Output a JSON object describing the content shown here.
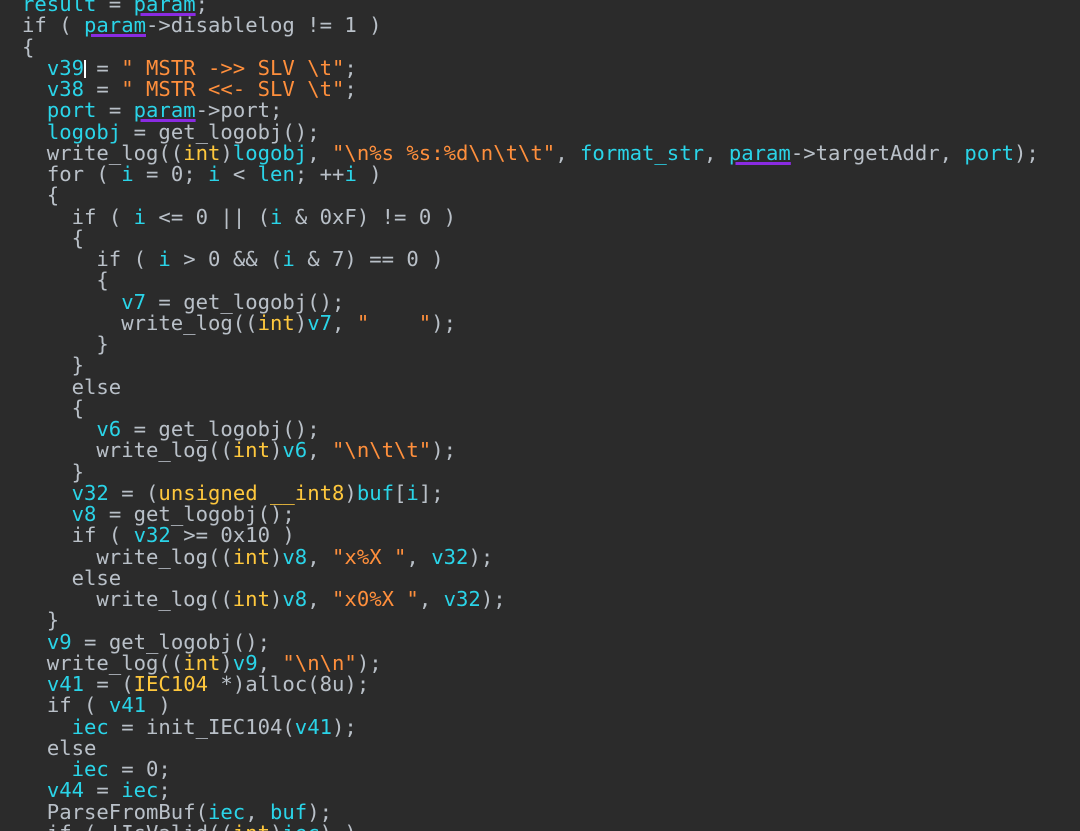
{
  "code_lines": [
    [
      [
        "var",
        "result"
      ],
      [
        "pl",
        " = "
      ],
      [
        "hl",
        "param"
      ],
      [
        "pl",
        ";"
      ]
    ],
    [
      [
        "kw",
        "if ( "
      ],
      [
        "hl",
        "param"
      ],
      [
        "pl",
        "->disablelog != 1 )"
      ]
    ],
    [
      [
        "pl",
        "{"
      ]
    ],
    [
      [
        "pl",
        "  "
      ],
      [
        "var",
        "v39"
      ],
      [
        "cur",
        ""
      ],
      [
        "pl",
        " = "
      ],
      [
        "str",
        "\" MSTR ->> SLV \\t\""
      ],
      [
        "pl",
        ";"
      ]
    ],
    [
      [
        "pl",
        "  "
      ],
      [
        "var",
        "v38"
      ],
      [
        "pl",
        " = "
      ],
      [
        "str",
        "\" MSTR <<- SLV \\t\""
      ],
      [
        "pl",
        ";"
      ]
    ],
    [
      [
        "pl",
        "  "
      ],
      [
        "var",
        "port"
      ],
      [
        "pl",
        " = "
      ],
      [
        "hl",
        "param"
      ],
      [
        "pl",
        "->port;"
      ]
    ],
    [
      [
        "pl",
        "  "
      ],
      [
        "var",
        "logobj"
      ],
      [
        "pl",
        " = get_logobj();"
      ]
    ],
    [
      [
        "pl",
        "  write_log(("
      ],
      [
        "typ",
        "int"
      ],
      [
        "pl",
        ")"
      ],
      [
        "var",
        "logobj"
      ],
      [
        "pl",
        ", "
      ],
      [
        "str",
        "\"\\n%s %s:%d\\n\\t\\t\""
      ],
      [
        "pl",
        ", "
      ],
      [
        "var",
        "format_str"
      ],
      [
        "pl",
        ", "
      ],
      [
        "hl",
        "param"
      ],
      [
        "pl",
        "->targetAddr, "
      ],
      [
        "var",
        "port"
      ],
      [
        "pl",
        ");"
      ]
    ],
    [
      [
        "pl",
        "  "
      ],
      [
        "kw",
        "for"
      ],
      [
        "pl",
        " ( "
      ],
      [
        "var",
        "i"
      ],
      [
        "pl",
        " = 0; "
      ],
      [
        "var",
        "i"
      ],
      [
        "pl",
        " < "
      ],
      [
        "var",
        "len"
      ],
      [
        "pl",
        "; ++"
      ],
      [
        "var",
        "i"
      ],
      [
        "pl",
        " )"
      ]
    ],
    [
      [
        "pl",
        "  {"
      ]
    ],
    [
      [
        "pl",
        "    "
      ],
      [
        "kw",
        "if"
      ],
      [
        "pl",
        " ( "
      ],
      [
        "var",
        "i"
      ],
      [
        "pl",
        " <= 0 || ("
      ],
      [
        "var",
        "i"
      ],
      [
        "pl",
        " & 0xF) != 0 )"
      ]
    ],
    [
      [
        "pl",
        "    {"
      ]
    ],
    [
      [
        "pl",
        "      "
      ],
      [
        "kw",
        "if"
      ],
      [
        "pl",
        " ( "
      ],
      [
        "var",
        "i"
      ],
      [
        "pl",
        " > 0 && ("
      ],
      [
        "var",
        "i"
      ],
      [
        "pl",
        " & 7) == 0 )"
      ]
    ],
    [
      [
        "pl",
        "      {"
      ]
    ],
    [
      [
        "pl",
        "        "
      ],
      [
        "var",
        "v7"
      ],
      [
        "pl",
        " = get_logobj();"
      ]
    ],
    [
      [
        "pl",
        "        write_log(("
      ],
      [
        "typ",
        "int"
      ],
      [
        "pl",
        ")"
      ],
      [
        "var",
        "v7"
      ],
      [
        "pl",
        ", "
      ],
      [
        "str",
        "\"    \""
      ],
      [
        "pl",
        ");"
      ]
    ],
    [
      [
        "pl",
        "      }"
      ]
    ],
    [
      [
        "pl",
        "    }"
      ]
    ],
    [
      [
        "pl",
        "    "
      ],
      [
        "kw",
        "else"
      ]
    ],
    [
      [
        "pl",
        "    {"
      ]
    ],
    [
      [
        "pl",
        "      "
      ],
      [
        "var",
        "v6"
      ],
      [
        "pl",
        " = get_logobj();"
      ]
    ],
    [
      [
        "pl",
        "      write_log(("
      ],
      [
        "typ",
        "int"
      ],
      [
        "pl",
        ")"
      ],
      [
        "var",
        "v6"
      ],
      [
        "pl",
        ", "
      ],
      [
        "str",
        "\"\\n\\t\\t\""
      ],
      [
        "pl",
        ");"
      ]
    ],
    [
      [
        "pl",
        "    }"
      ]
    ],
    [
      [
        "pl",
        "    "
      ],
      [
        "var",
        "v32"
      ],
      [
        "pl",
        " = ("
      ],
      [
        "typ",
        "unsigned __int8"
      ],
      [
        "pl",
        ")"
      ],
      [
        "var",
        "buf"
      ],
      [
        "pl",
        "["
      ],
      [
        "var",
        "i"
      ],
      [
        "pl",
        "];"
      ]
    ],
    [
      [
        "pl",
        "    "
      ],
      [
        "var",
        "v8"
      ],
      [
        "pl",
        " = get_logobj();"
      ]
    ],
    [
      [
        "pl",
        "    "
      ],
      [
        "kw",
        "if"
      ],
      [
        "pl",
        " ( "
      ],
      [
        "var",
        "v32"
      ],
      [
        "pl",
        " >= 0x10 )"
      ]
    ],
    [
      [
        "pl",
        "      write_log(("
      ],
      [
        "typ",
        "int"
      ],
      [
        "pl",
        ")"
      ],
      [
        "var",
        "v8"
      ],
      [
        "pl",
        ", "
      ],
      [
        "str",
        "\"x%X \""
      ],
      [
        "pl",
        ", "
      ],
      [
        "var",
        "v32"
      ],
      [
        "pl",
        ");"
      ]
    ],
    [
      [
        "pl",
        "    "
      ],
      [
        "kw",
        "else"
      ]
    ],
    [
      [
        "pl",
        "      write_log(("
      ],
      [
        "typ",
        "int"
      ],
      [
        "pl",
        ")"
      ],
      [
        "var",
        "v8"
      ],
      [
        "pl",
        ", "
      ],
      [
        "str",
        "\"x0%X \""
      ],
      [
        "pl",
        ", "
      ],
      [
        "var",
        "v32"
      ],
      [
        "pl",
        ");"
      ]
    ],
    [
      [
        "pl",
        "  }"
      ]
    ],
    [
      [
        "pl",
        "  "
      ],
      [
        "var",
        "v9"
      ],
      [
        "pl",
        " = get_logobj();"
      ]
    ],
    [
      [
        "pl",
        "  write_log(("
      ],
      [
        "typ",
        "int"
      ],
      [
        "pl",
        ")"
      ],
      [
        "var",
        "v9"
      ],
      [
        "pl",
        ", "
      ],
      [
        "str",
        "\"\\n\\n\""
      ],
      [
        "pl",
        ");"
      ]
    ],
    [
      [
        "pl",
        "  "
      ],
      [
        "var",
        "v41"
      ],
      [
        "pl",
        " = ("
      ],
      [
        "typ",
        "IEC104"
      ],
      [
        "pl",
        " *)alloc(8u);"
      ]
    ],
    [
      [
        "pl",
        "  "
      ],
      [
        "kw",
        "if"
      ],
      [
        "pl",
        " ( "
      ],
      [
        "var",
        "v41"
      ],
      [
        "pl",
        " )"
      ]
    ],
    [
      [
        "pl",
        "    "
      ],
      [
        "var",
        "iec"
      ],
      [
        "pl",
        " = init_IEC104("
      ],
      [
        "var",
        "v41"
      ],
      [
        "pl",
        ");"
      ]
    ],
    [
      [
        "pl",
        "  "
      ],
      [
        "kw",
        "else"
      ]
    ],
    [
      [
        "pl",
        "    "
      ],
      [
        "var",
        "iec"
      ],
      [
        "pl",
        " = 0;"
      ]
    ],
    [
      [
        "pl",
        "  "
      ],
      [
        "var",
        "v44"
      ],
      [
        "pl",
        " = "
      ],
      [
        "var",
        "iec"
      ],
      [
        "pl",
        ";"
      ]
    ],
    [
      [
        "pl",
        "  ParseFromBuf("
      ],
      [
        "var",
        "iec"
      ],
      [
        "pl",
        ", "
      ],
      [
        "var",
        "buf"
      ],
      [
        "pl",
        ");"
      ]
    ],
    [
      [
        "pl",
        "  "
      ],
      [
        "kw",
        "if"
      ],
      [
        "pl",
        " ( !IsValid(("
      ],
      [
        "typ",
        "int"
      ],
      [
        "pl",
        ")"
      ],
      [
        "var",
        "iec"
      ],
      [
        "pl",
        ") )"
      ]
    ]
  ],
  "colors": {
    "background": "#2b2b2b",
    "identifier": "#2ad4e8",
    "string": "#ff8f3c",
    "type": "#ffc83d",
    "plain": "#b9c0c8",
    "param_underline": "#8a2be2"
  }
}
